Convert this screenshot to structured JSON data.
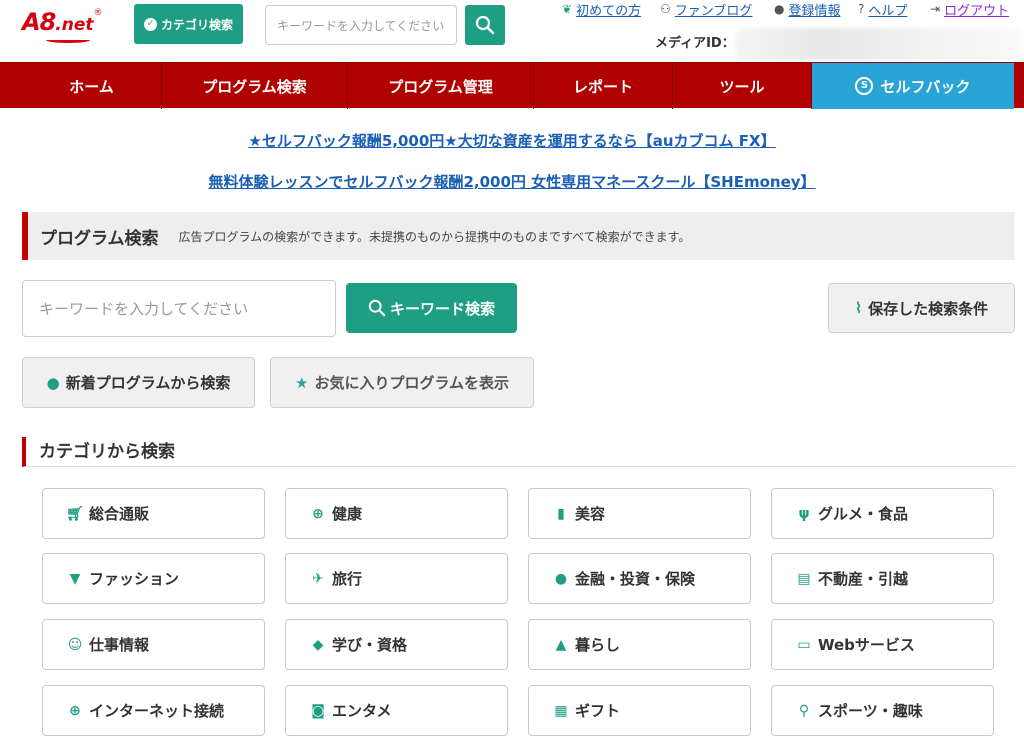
{
  "header": {
    "logo": {
      "main": "A8",
      "sub": ".net",
      "reg": "®"
    },
    "category_button": "カテゴリ検索",
    "search_placeholder": "キーワードを入力してください",
    "links": [
      {
        "label": "初めての方",
        "icon": "leaf-icon"
      },
      {
        "label": "ファンブログ",
        "icon": "people-icon"
      },
      {
        "label": "登録情報",
        "icon": "person-icon"
      },
      {
        "label": "ヘルプ",
        "icon": "question-icon"
      },
      {
        "label": "ログアウト",
        "icon": "logout-icon"
      }
    ],
    "media_id_label": "メディアID："
  },
  "nav": {
    "items": [
      "ホーム",
      "プログラム検索",
      "プログラム管理",
      "レポート",
      "ツール",
      "セルフバック"
    ],
    "selected": "セルフバック"
  },
  "promos": [
    "★セルフバック報酬5,000円★大切な資産を運用するなら【auカブコム FX】",
    "無料体験レッスンでセルフバック報酬2,000円 女性専用マネースクール【SHEmoney】"
  ],
  "program_search": {
    "title": "プログラム検索",
    "description": "広告プログラムの検索ができます。未提携のものから提携中のものまですべて検索ができます。",
    "keyword_placeholder": "キーワードを入力してください",
    "keyword_button": "キーワード検索",
    "saved_button": "保存した検索条件",
    "new_button": "新着プログラムから検索",
    "fav_button": "お気に入りプログラムを表示"
  },
  "categories": {
    "title": "カテゴリから検索",
    "items": [
      {
        "label": "総合通販",
        "icon": "cart-icon"
      },
      {
        "label": "健康",
        "icon": "first-aid-icon"
      },
      {
        "label": "美容",
        "icon": "lipstick-icon"
      },
      {
        "label": "グルメ・食品",
        "icon": "cutlery-icon"
      },
      {
        "label": "ファッション",
        "icon": "dress-icon"
      },
      {
        "label": "旅行",
        "icon": "plane-icon"
      },
      {
        "label": "金融・投資・保険",
        "icon": "money-bag-icon"
      },
      {
        "label": "不動産・引越",
        "icon": "house-icon"
      },
      {
        "label": "仕事情報",
        "icon": "worker-icon"
      },
      {
        "label": "学び・資格",
        "icon": "graduation-cap-icon"
      },
      {
        "label": "暮らし",
        "icon": "lamp-icon"
      },
      {
        "label": "Webサービス",
        "icon": "monitor-icon"
      },
      {
        "label": "インターネット接続",
        "icon": "globe-icon"
      },
      {
        "label": "エンタメ",
        "icon": "camera-icon"
      },
      {
        "label": "ギフト",
        "icon": "gift-icon"
      },
      {
        "label": "スポーツ・趣味",
        "icon": "sports-icon"
      }
    ]
  },
  "colors": {
    "brand_red": "#b00000",
    "accent_green": "#1e9e82",
    "selfback_blue": "#2aa4d6",
    "link_blue": "#1a5fb4"
  }
}
